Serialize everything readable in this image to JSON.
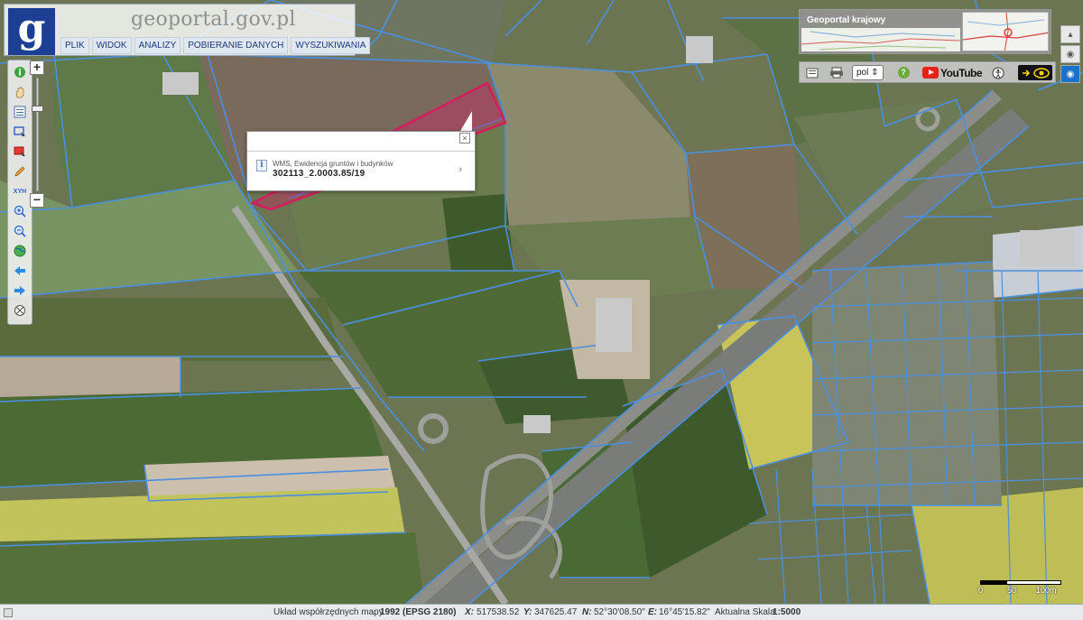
{
  "header": {
    "logo_letter": "g",
    "brand": "geoportal.gov.pl",
    "menu": [
      "PLIK",
      "WIDOK",
      "ANALIZY",
      "POBIERANIE DANYCH",
      "WYSZUKIWANIA"
    ]
  },
  "toolbar": {
    "zoom_in": "+",
    "zoom_out": "−",
    "tools": [
      "info-icon",
      "pan-hand-icon",
      "legend-icon",
      "select-area-icon",
      "select-object-icon",
      "measure-pencil-icon",
      "coordinates-xyh-icon",
      "zoom-in-icon",
      "zoom-out-icon",
      "full-extent-globe-icon",
      "back-arrow-icon",
      "forward-arrow-icon",
      "reset-view-icon"
    ],
    "xyh_label": "XYH"
  },
  "popup": {
    "source": "WMS, Ewidencja gruntów i budynków",
    "value": "302113_2.0003.85/19",
    "close": "×",
    "chevron": "›"
  },
  "national_panel": {
    "title": "Geoportal krajowy"
  },
  "actionbar": {
    "language": "pol",
    "language_arrow": "⇕",
    "youtube_label": "YouTube",
    "help": "?"
  },
  "scale_bar": {
    "labels": [
      "0",
      "50",
      "100m"
    ]
  },
  "status": {
    "crs_label": "Układ współrzędnych mapy",
    "crs_value": "1992 (EPSG 2180)",
    "x_label": "X:",
    "x_value": "517538.52",
    "y_label": "Y:",
    "y_value": "347625.47",
    "n_label": "N:",
    "n_value": "52°30'08.50\"",
    "e_label": "E:",
    "e_value": "16°45'15.82\"",
    "scale_label": "Aktualna Skala",
    "scale_value": "1:5000"
  },
  "colors": {
    "parcel_lines": "#4a90e2",
    "selected_parcel": "#d81b60",
    "logo_blue": "#1c3f94"
  }
}
